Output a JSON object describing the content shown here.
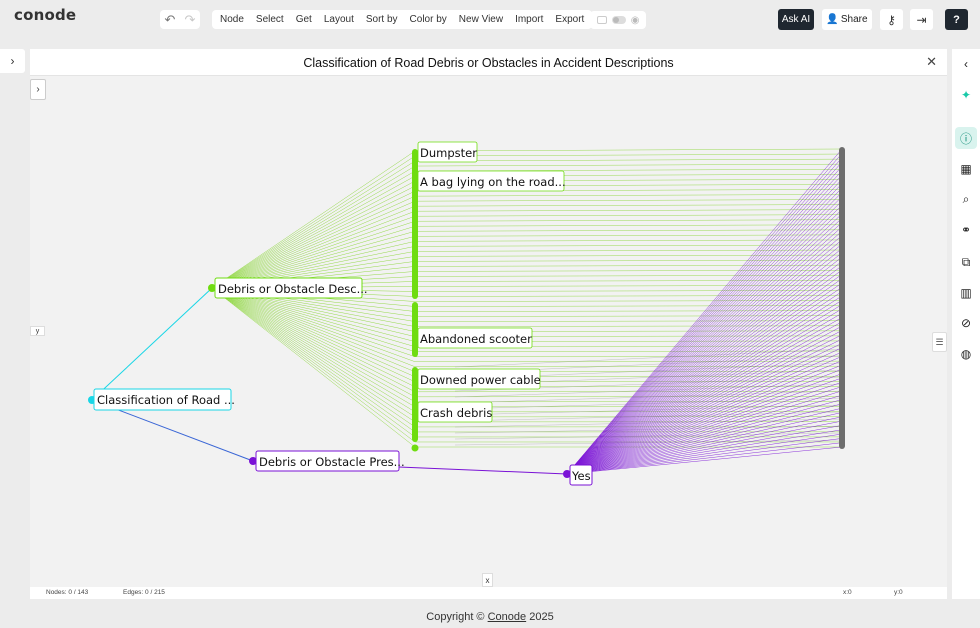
{
  "app": {
    "logo": "conode"
  },
  "toolbar": {
    "undo_icon": "undo-icon",
    "redo_icon": "redo-icon",
    "menu": [
      "Node",
      "Select",
      "Get",
      "Layout",
      "Sort by",
      "Color by",
      "New View",
      "Import",
      "Export"
    ],
    "ask_ai": "Ask AI",
    "share": "Share",
    "help": "?"
  },
  "panel": {
    "title": "Classification of Road Debris or Obstacles in Accident Descriptions",
    "close": "✕",
    "y_label": "y",
    "x_label": "x",
    "status": {
      "nodes": "Nodes: 0 / 143",
      "edges": "Edges: 0 / 215",
      "x": "x:0",
      "y": "y:0"
    }
  },
  "graph": {
    "root": {
      "label": "Classification of Road ...",
      "color": "#19d6e6"
    },
    "child_a": {
      "label": "Debris or Obstacle Desc...",
      "color": "#6fdc10"
    },
    "child_b": {
      "label": "Debris or Obstacle Pres...",
      "color": "#7a12d6"
    },
    "yes": {
      "label": "Yes",
      "color": "#7a12d6"
    },
    "leaves": [
      "Dumpster",
      "A bag lying on the road...",
      "Abandoned scooter",
      "Downed power cable",
      "Crash debris"
    ],
    "sink_color": "#6d6d6d",
    "edge_green": "#7ed321",
    "edge_purple": "#7a12d6",
    "edge_gray": "#8a8a8a"
  },
  "footer": {
    "prefix": "Copyright ©",
    "link": "Conode",
    "year": "2025"
  }
}
